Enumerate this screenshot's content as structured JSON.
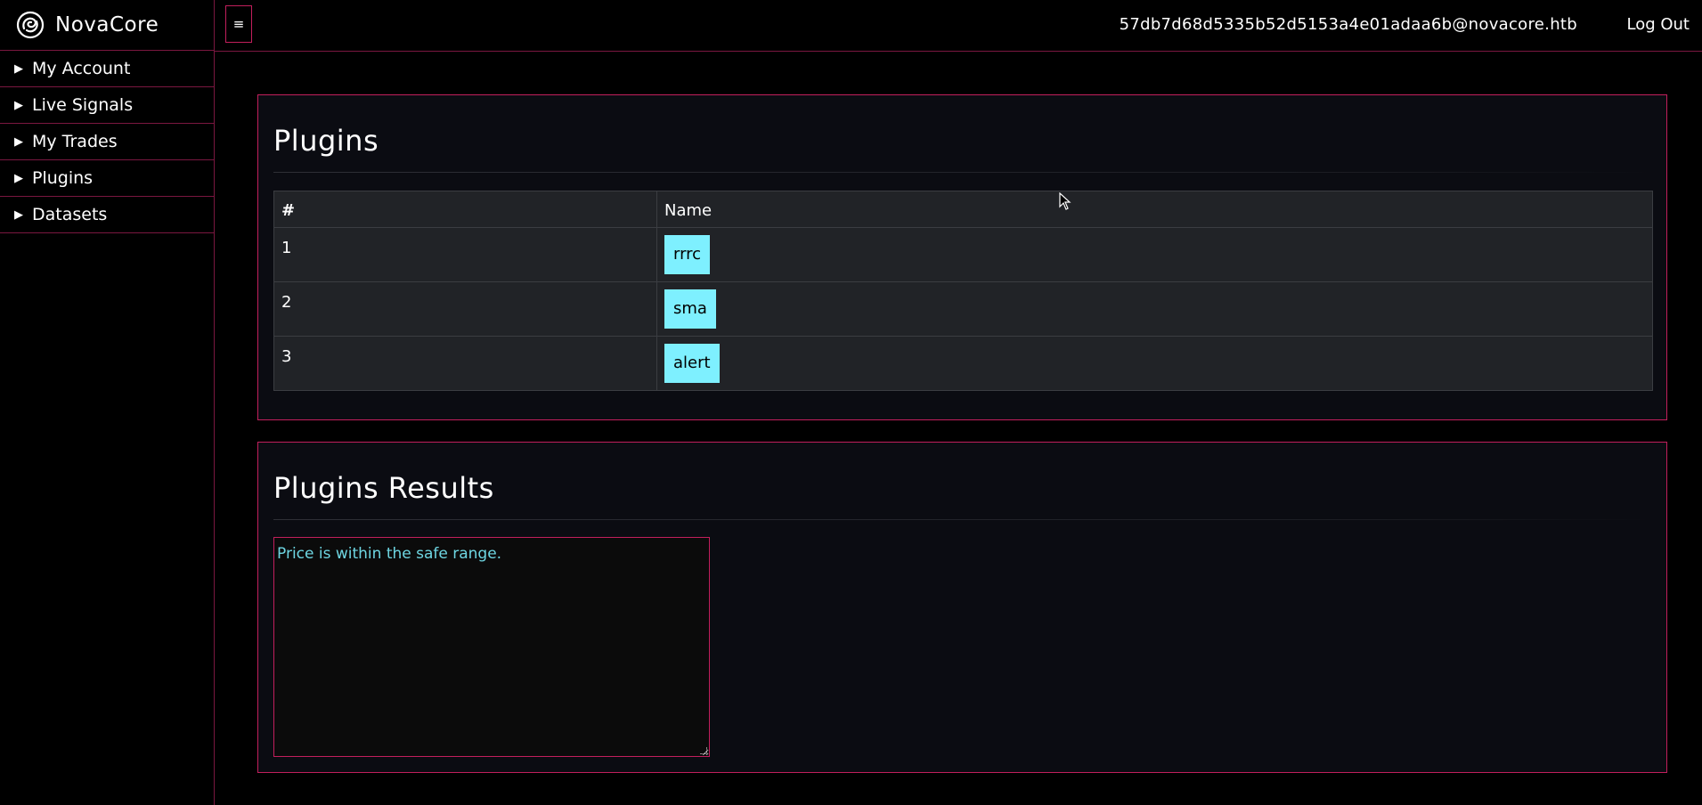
{
  "brand": {
    "name": "NovaCore",
    "icon": "swirl-logo-icon"
  },
  "topbar": {
    "menu_icon": "≡",
    "user_email": "57db7d68d5335b52d5153a4e01adaa6b@novacore.htb",
    "logout_label": "Log Out"
  },
  "sidebar": {
    "items": [
      {
        "arrow": "▶",
        "label": "My Account"
      },
      {
        "arrow": "▶",
        "label": "Live Signals"
      },
      {
        "arrow": "▶",
        "label": "My Trades"
      },
      {
        "arrow": "▶",
        "label": "Plugins"
      },
      {
        "arrow": "▶",
        "label": "Datasets"
      }
    ]
  },
  "plugins": {
    "title": "Plugins",
    "columns": [
      "#",
      "Name"
    ],
    "rows": [
      {
        "num": "1",
        "name": "rrrc"
      },
      {
        "num": "2",
        "name": "sma"
      },
      {
        "num": "3",
        "name": "alert"
      }
    ]
  },
  "results": {
    "title": "Plugins Results",
    "output": "Price is within the safe range."
  },
  "colors": {
    "accent": "#c21f5c",
    "button": "#7ef0ff",
    "output_text": "#6ed6e2",
    "background": "#000000",
    "panel": "#0b0c12"
  }
}
